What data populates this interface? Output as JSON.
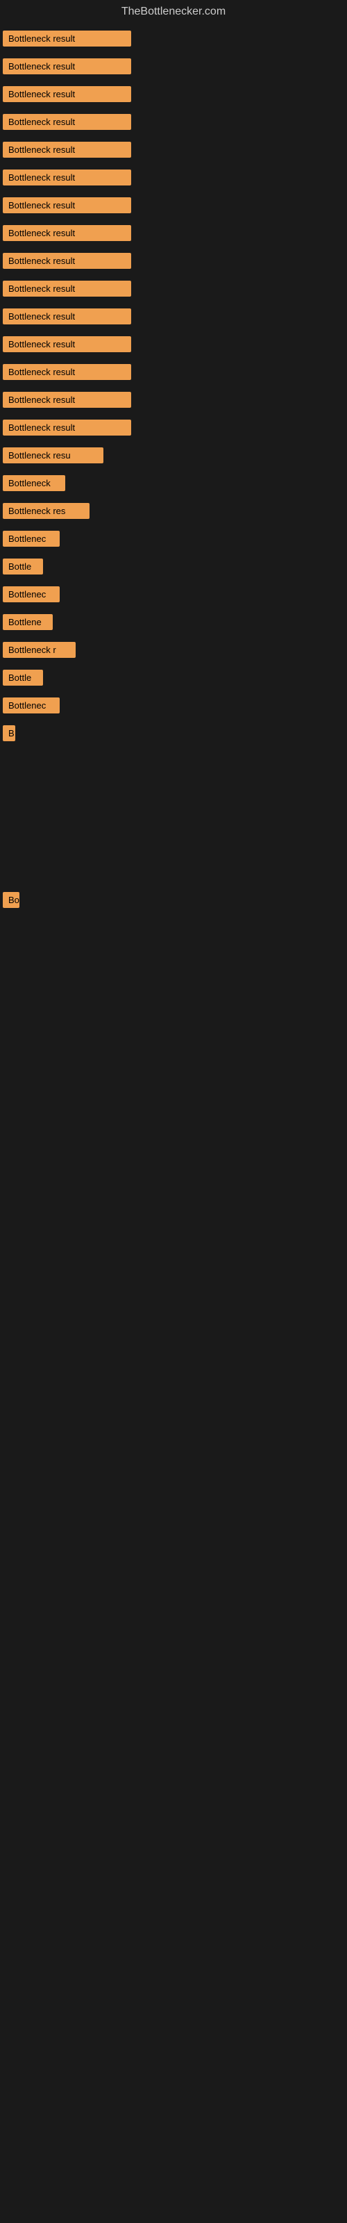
{
  "header": {
    "title": "TheBottlenecker.com"
  },
  "items": [
    {
      "label": "Bottleneck result",
      "width": 185
    },
    {
      "label": "Bottleneck result",
      "width": 185
    },
    {
      "label": "Bottleneck result",
      "width": 185
    },
    {
      "label": "Bottleneck result",
      "width": 185
    },
    {
      "label": "Bottleneck result",
      "width": 185
    },
    {
      "label": "Bottleneck result",
      "width": 185
    },
    {
      "label": "Bottleneck result",
      "width": 185
    },
    {
      "label": "Bottleneck result",
      "width": 185
    },
    {
      "label": "Bottleneck result",
      "width": 185
    },
    {
      "label": "Bottleneck result",
      "width": 185
    },
    {
      "label": "Bottleneck result",
      "width": 185
    },
    {
      "label": "Bottleneck result",
      "width": 185
    },
    {
      "label": "Bottleneck result",
      "width": 185
    },
    {
      "label": "Bottleneck result",
      "width": 185
    },
    {
      "label": "Bottleneck result",
      "width": 185
    },
    {
      "label": "Bottleneck resu",
      "width": 145
    },
    {
      "label": "Bottleneck",
      "width": 90
    },
    {
      "label": "Bottleneck res",
      "width": 125
    },
    {
      "label": "Bottlenec",
      "width": 82
    },
    {
      "label": "Bottle",
      "width": 58
    },
    {
      "label": "Bottlenec",
      "width": 82
    },
    {
      "label": "Bottlene",
      "width": 72
    },
    {
      "label": "Bottleneck r",
      "width": 105
    },
    {
      "label": "Bottle",
      "width": 58
    },
    {
      "label": "Bottlenec",
      "width": 82
    },
    {
      "label": "B",
      "width": 18
    },
    {
      "label": "",
      "width": 0
    },
    {
      "label": "",
      "width": 0
    },
    {
      "label": "",
      "width": 0
    },
    {
      "label": "",
      "width": 0
    },
    {
      "label": "Bo",
      "width": 24
    },
    {
      "label": "",
      "width": 0
    },
    {
      "label": "",
      "width": 0
    },
    {
      "label": "",
      "width": 0
    },
    {
      "label": "",
      "width": 0
    },
    {
      "label": "",
      "width": 0
    },
    {
      "label": "",
      "width": 0
    }
  ]
}
